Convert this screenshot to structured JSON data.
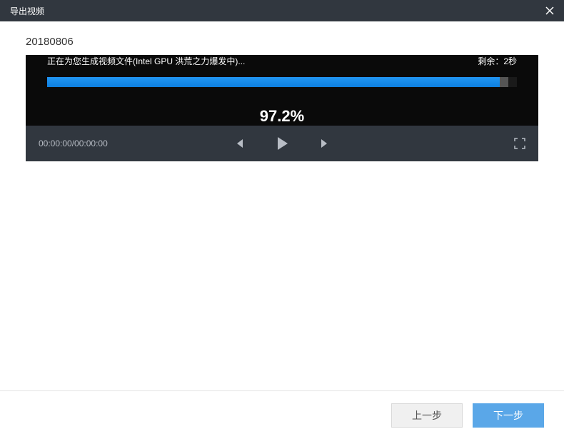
{
  "titlebar": {
    "title": "导出视频"
  },
  "video": {
    "name": "20180806",
    "status_text": "正在为您生成视频文件(Intel GPU 洪荒之力爆发中)...",
    "remaining_label": "剩余：2秒",
    "progress_pct": "97.2%",
    "progress_value": 97.2
  },
  "player": {
    "time_display": "00:00:00/00:00:00"
  },
  "footer": {
    "prev_label": "上一步",
    "next_label": "下一步"
  }
}
